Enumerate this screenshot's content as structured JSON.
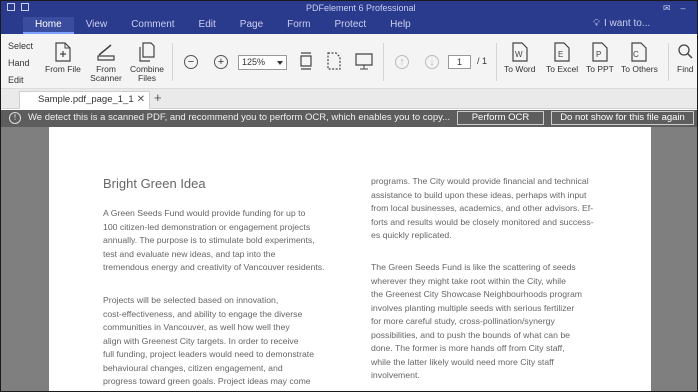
{
  "app": {
    "title": "PDFelement 6 Professional"
  },
  "menu": {
    "tabs": [
      "Home",
      "View",
      "Comment",
      "Edit",
      "Page",
      "Form",
      "Protect",
      "Help"
    ],
    "search_label": "I want to..."
  },
  "ribbon": {
    "select": "Select",
    "hand": "Hand",
    "edit": "Edit",
    "from_file": "From File",
    "from_scanner": "From Scanner",
    "combine_files": "Combine Files",
    "zoom": "125%",
    "page_current": "1",
    "page_total": "/ 1",
    "to_word": "To Word",
    "to_excel": "To Excel",
    "to_ppt": "To PPT",
    "to_others": "To Others",
    "find": "Find"
  },
  "tab": {
    "name": "Sample.pdf_page_1_1"
  },
  "ocr_bar": {
    "message": "We detect this is a scanned PDF, and recommend you to perform OCR, which enables you to copy...",
    "perform_label": "Perform OCR",
    "dismiss_label": "Do not show for this file again"
  },
  "document": {
    "heading": "Bright Green Idea",
    "left_p1": [
      "A Green Seeds Fund would provide funding for up to",
      "100 citizen-led demonstration or engagement projects",
      "annually. The purpose is to stimulate bold experiments,",
      "test and evaluate new ideas, and tap into the",
      "tremendous energy and creativity of Vancouver residents."
    ],
    "left_p2": [
      "Projects will be selected based on innovation,",
      "cost-effectiveness, and ability to engage the diverse",
      "communities in Vancouver, as well how well they",
      "align with Greenest City targets. In order to receive",
      "full funding, project leaders would need to demonstrate",
      "behavioural changes, citizen engagement, and",
      "progress toward green goals. Project ideas may come"
    ],
    "right_p1": [
      "programs. The City would provide financial and technical",
      "assistance to build upon these ideas, perhaps with input",
      "from local businesses, academics, and other advisors. Ef-",
      "forts and results would be closely monitored and success-",
      "es quickly replicated."
    ],
    "right_p2": [
      "The Green Seeds Fund is like the scattering of seeds",
      "wherever they might take root within the City, while",
      "the Greenest City Showcase Neighbourhoods program",
      "involves planting multiple seeds with serious fertilizer",
      "for more careful study, cross-pollination/synergy",
      "possibilities, and to push the bounds of what can be",
      "done. The former is more hands off from City staff,",
      "while the latter likely would need more City staff",
      "involvement."
    ]
  }
}
